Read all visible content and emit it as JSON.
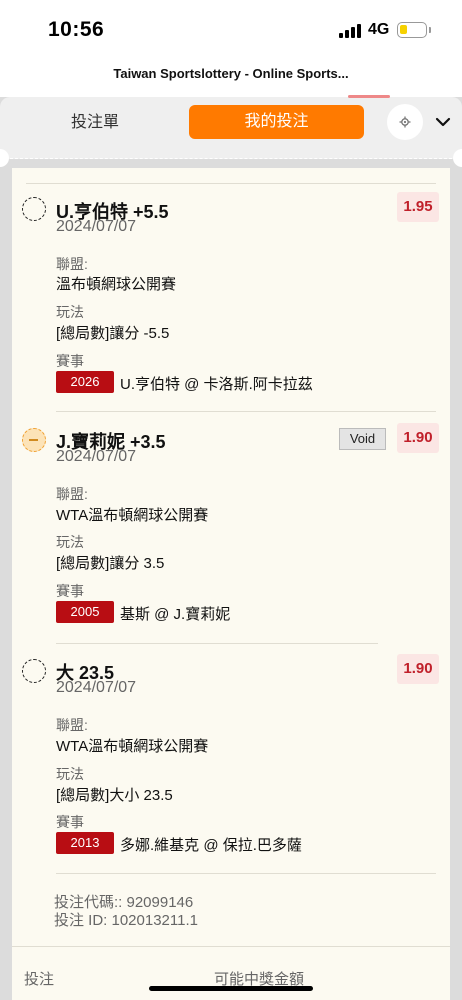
{
  "status": {
    "time": "10:56",
    "network": "4G"
  },
  "page_title": "Taiwan Sportslottery - Online Sports...",
  "tabs": {
    "betslip": "投注單",
    "my_bets": "我的投注"
  },
  "icons": {
    "settings": "gear-icon",
    "chevron": "chevron-down-icon"
  },
  "colors": {
    "accent": "#ff7a00",
    "odds_red": "#c0202a",
    "event_code_bg": "#b80d13"
  },
  "legs": [
    {
      "selection": "U.亨伯特 +5.5",
      "date": "2024/07/07",
      "odds": "1.95",
      "status_badge": "",
      "league_label": "聯盟:",
      "league": "溫布頓網球公開賽",
      "market_label": "玩法",
      "market": "[總局數]讓分 -5.5",
      "event_label": "賽事",
      "event_code": "2026",
      "event": "U.亨伯特 @ 卡洛斯.阿卡拉茲"
    },
    {
      "selection": "J.寶莉妮 +3.5",
      "date": "2024/07/07",
      "odds": "1.90",
      "status_badge": "Void",
      "league_label": "聯盟:",
      "league": "WTA溫布頓網球公開賽",
      "market_label": "玩法",
      "market": "[總局數]讓分 3.5",
      "event_label": "賽事",
      "event_code": "2005",
      "event": "基斯 @ J.寶莉妮"
    },
    {
      "selection": "大 23.5",
      "date": "2024/07/07",
      "odds": "1.90",
      "status_badge": "",
      "league_label": "聯盟:",
      "league": "WTA溫布頓網球公開賽",
      "market_label": "玩法",
      "market": "[總局數]大小 23.5",
      "event_label": "賽事",
      "event_code": "2013",
      "event": "多娜.維基克 @ 保拉.巴多薩"
    }
  ],
  "bet_code": "投注代碼:: 92099146",
  "bet_id": "投注 ID: 102013211.1",
  "footer": {
    "stake_label": "投注",
    "potential_win_label": "可能中獎金額"
  }
}
